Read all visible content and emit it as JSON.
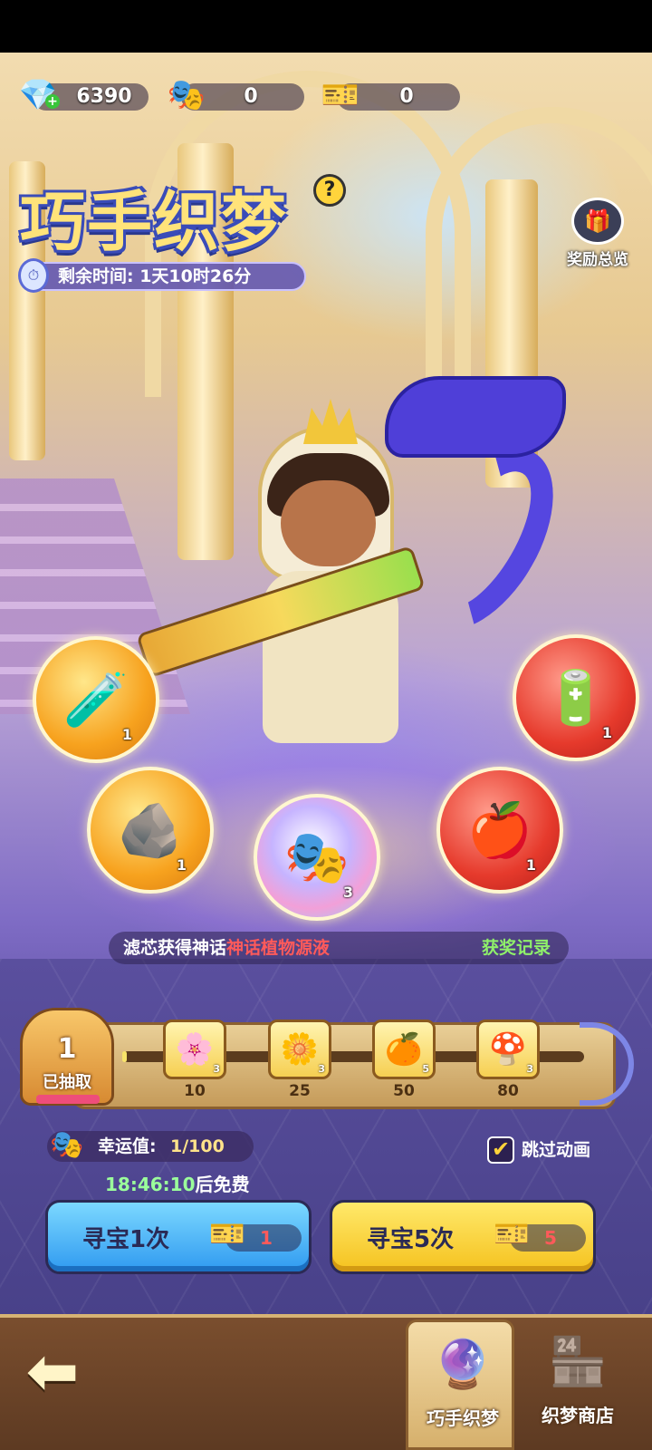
{
  "currencies": [
    {
      "name": "diamond",
      "icon": "💎",
      "value": "6390"
    },
    {
      "name": "mask",
      "icon": "🎭",
      "value": "0"
    },
    {
      "name": "ticket",
      "icon": "🎫",
      "value": "0"
    }
  ],
  "title": "巧手织梦",
  "help_glyph": "?",
  "timer": {
    "icon": "⏱",
    "text": "剩余时间: 1天10时26分"
  },
  "reward_overview": {
    "icon": "🎁",
    "label": "奖励总览"
  },
  "orbs": [
    {
      "name": "potion",
      "icon": "🧪",
      "count": "1",
      "style": "gold"
    },
    {
      "name": "battery",
      "icon": "🔋",
      "count": "1",
      "style": "red"
    },
    {
      "name": "stone",
      "icon": "🪨",
      "count": "1",
      "style": "gold"
    },
    {
      "name": "mask",
      "icon": "🎭",
      "count": "3",
      "style": "rainbow"
    },
    {
      "name": "fruit",
      "icon": "🍎",
      "count": "1",
      "style": "red"
    }
  ],
  "ticker": {
    "prefix": "滤芯获得神话",
    "highlight": "神话植物源液",
    "record_link": "获奖记录"
  },
  "progress": {
    "draws": "1",
    "draws_label": "已抽取",
    "fill_fraction": 0.01,
    "milestones": [
      {
        "icon": "🌸",
        "count": "3",
        "threshold": "10"
      },
      {
        "icon": "🌼",
        "count": "3",
        "threshold": "25"
      },
      {
        "icon": "🍊",
        "count": "5",
        "threshold": "50"
      },
      {
        "icon": "🍄",
        "count": "3",
        "threshold": "80"
      }
    ]
  },
  "luck": {
    "icon": "🎭",
    "label": "幸运值:",
    "value": "1/100"
  },
  "skip_animation": {
    "checked": true,
    "check_glyph": "✔",
    "label": "跳过动画"
  },
  "free_timer": {
    "time": "18:46:10",
    "suffix": "后免费"
  },
  "actions": [
    {
      "label": "寻宝1次",
      "ticket_icon": "🎫",
      "cost": "1"
    },
    {
      "label": "寻宝5次",
      "ticket_icon": "🎫",
      "cost": "5"
    }
  ],
  "bottom_nav": {
    "back_glyph": "⬅",
    "tabs": [
      {
        "label": "巧手织梦",
        "icon": "🔮",
        "active": true
      },
      {
        "label": "织梦商店",
        "icon": "🏪",
        "active": false
      }
    ]
  }
}
